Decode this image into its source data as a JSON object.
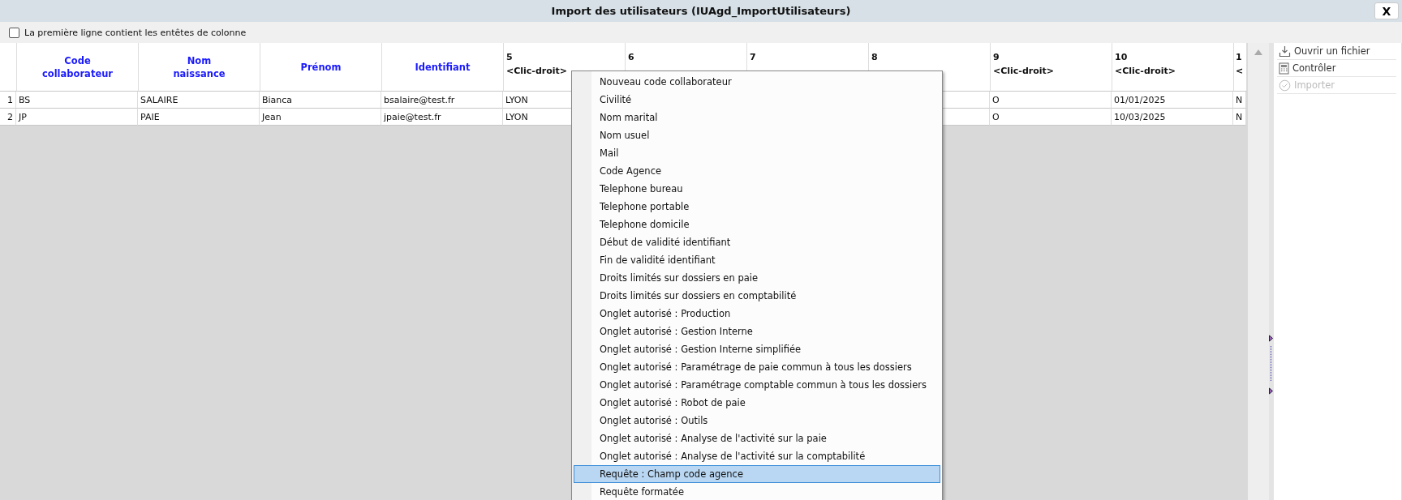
{
  "window": {
    "title": "Import des utilisateurs (IUAgd_ImportUtilisateurs)",
    "close": "X"
  },
  "header_option": {
    "label": "La première ligne contient les entêtes de colonne",
    "checked": false
  },
  "table": {
    "columns": [
      {
        "kind": "named",
        "lines": [
          "Code",
          "collaborateur"
        ]
      },
      {
        "kind": "named",
        "lines": [
          "Nom",
          "naissance"
        ]
      },
      {
        "kind": "named",
        "lines": [
          "Prénom"
        ]
      },
      {
        "kind": "named",
        "lines": [
          "Identifiant"
        ]
      },
      {
        "kind": "numbered",
        "lines": [
          "5",
          "<Clic-droit>"
        ]
      },
      {
        "kind": "numbered",
        "lines": [
          "6"
        ]
      },
      {
        "kind": "numbered",
        "lines": [
          "7"
        ]
      },
      {
        "kind": "numbered",
        "lines": [
          "8"
        ]
      },
      {
        "kind": "numbered",
        "lines": [
          "9",
          "<Clic-droit>"
        ]
      },
      {
        "kind": "numbered",
        "lines": [
          "10",
          "<Clic-droit>"
        ]
      },
      {
        "kind": "partial",
        "lines": [
          "1",
          "<"
        ]
      }
    ],
    "rows": [
      {
        "number": "1",
        "cells": [
          "BS",
          "SALAIRE",
          "Bianca",
          "bsalaire@test.fr",
          "LYON",
          null,
          null,
          null,
          "O",
          "01/01/2025",
          "N"
        ]
      },
      {
        "number": "2",
        "cells": [
          "JP",
          "PAIE",
          "Jean",
          "jpaie@test.fr",
          "LYON",
          null,
          null,
          null,
          "O",
          "10/03/2025",
          "N"
        ]
      }
    ]
  },
  "actions": [
    {
      "kind": "open",
      "label": "Ouvrir un fichier",
      "disabled": false
    },
    {
      "kind": "check",
      "label": "Contrôler",
      "disabled": false
    },
    {
      "kind": "import",
      "label": "Importer",
      "disabled": true
    }
  ],
  "context_menu": {
    "items": [
      {
        "label": "Nouveau code collaborateur",
        "selected": false
      },
      {
        "label": "Civilité",
        "selected": false
      },
      {
        "label": "Nom marital",
        "selected": false
      },
      {
        "label": "Nom usuel",
        "selected": false
      },
      {
        "label": "Mail",
        "selected": false
      },
      {
        "label": "Code Agence",
        "selected": false
      },
      {
        "label": "Telephone bureau",
        "selected": false
      },
      {
        "label": "Telephone portable",
        "selected": false
      },
      {
        "label": "Telephone domicile",
        "selected": false
      },
      {
        "label": "Début de validité identifiant",
        "selected": false
      },
      {
        "label": "Fin de validité identifiant",
        "selected": false
      },
      {
        "label": "Droits limités sur dossiers en paie",
        "selected": false
      },
      {
        "label": "Droits limités sur dossiers en comptabilité",
        "selected": false
      },
      {
        "label": "Onglet autorisé : Production",
        "selected": false
      },
      {
        "label": "Onglet autorisé : Gestion Interne",
        "selected": false
      },
      {
        "label": "Onglet autorisé : Gestion Interne simplifiée",
        "selected": false
      },
      {
        "label": "Onglet autorisé : Paramétrage de paie commun à tous les dossiers",
        "selected": false
      },
      {
        "label": "Onglet autorisé : Paramétrage comptable commun à tous les dossiers",
        "selected": false
      },
      {
        "label": "Onglet autorisé : Robot de paie",
        "selected": false
      },
      {
        "label": "Onglet autorisé : Outils",
        "selected": false
      },
      {
        "label": "Onglet autorisé : Analyse de l'activité sur la paie",
        "selected": false
      },
      {
        "label": "Onglet autorisé : Analyse de l'activité sur la comptabilité",
        "selected": false
      },
      {
        "label": "Requête : Champ code agence",
        "selected": true
      },
      {
        "label": "Requête formatée",
        "selected": false
      }
    ]
  }
}
